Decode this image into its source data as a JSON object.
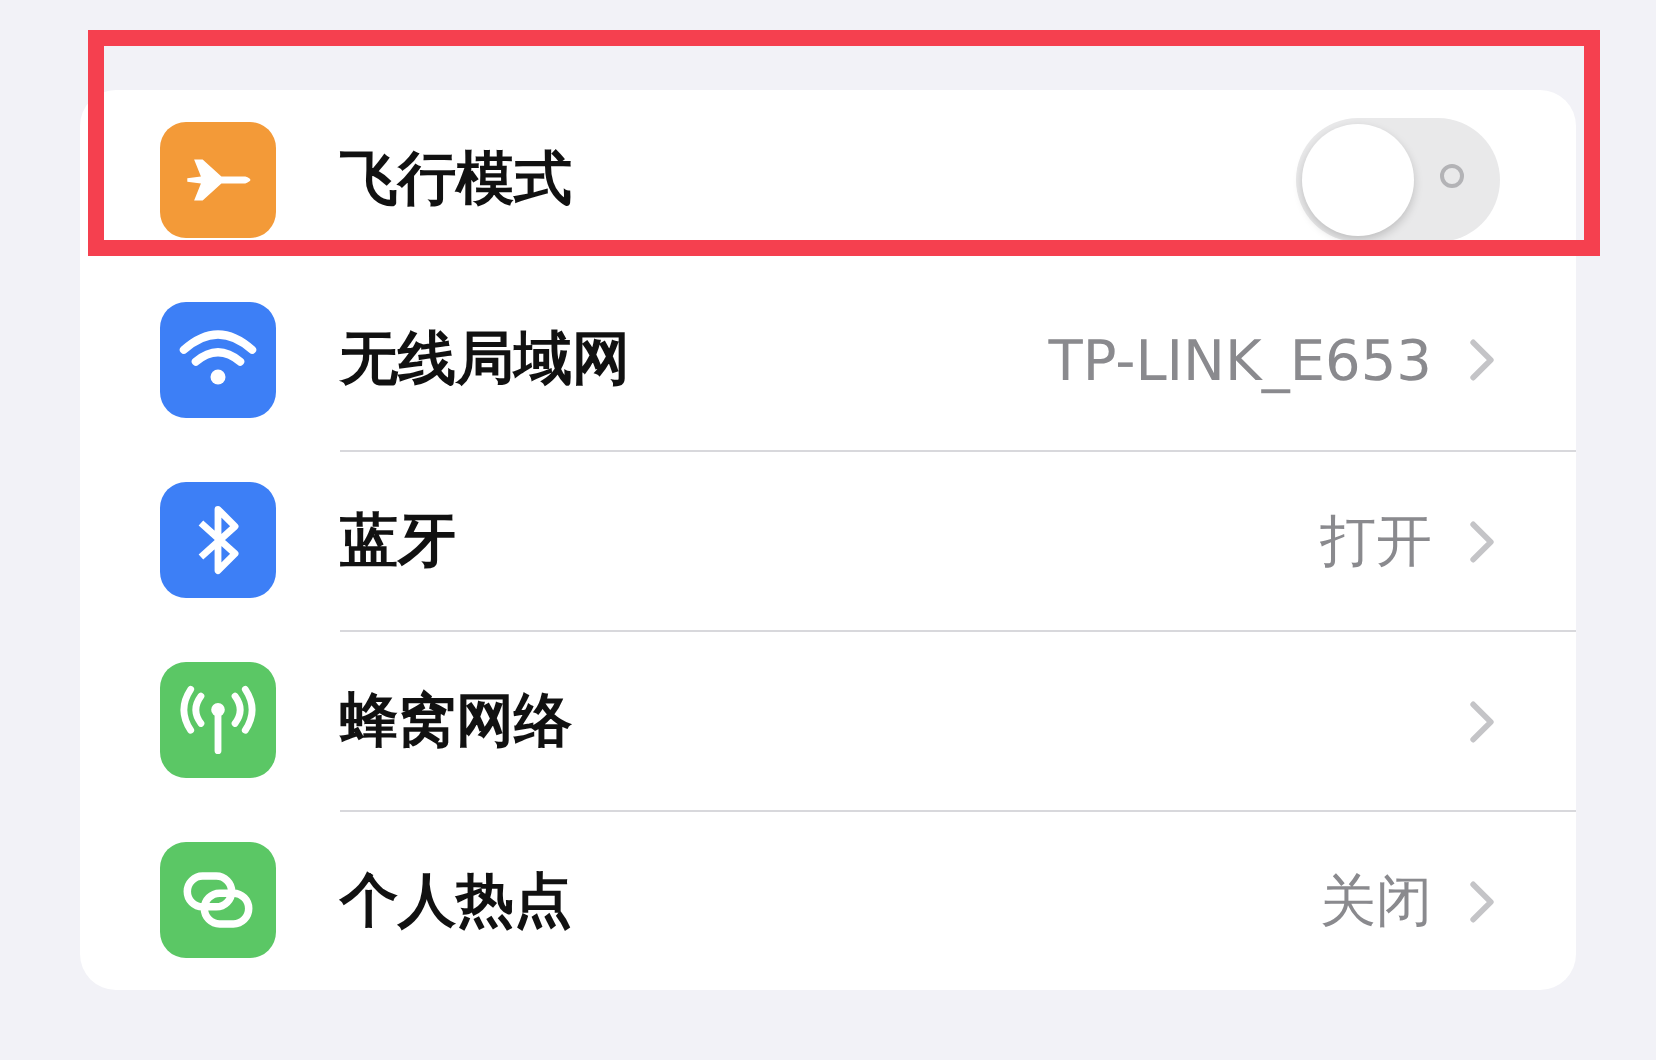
{
  "settings_rows": [
    {
      "label": "飞行模式",
      "kind": "toggle",
      "on": false,
      "color": "#f39a38",
      "highlighted": true
    },
    {
      "label": "无线局域网",
      "kind": "link",
      "value": "TP-LINK_E653",
      "color": "#3d7ff6",
      "highlighted": false
    },
    {
      "label": "蓝牙",
      "kind": "link",
      "value": "打开",
      "color": "#3d7ff6",
      "highlighted": false
    },
    {
      "label": "蜂窝网络",
      "kind": "link",
      "color": "#5bc765",
      "highlighted": false
    },
    {
      "label": "个人热点",
      "kind": "link",
      "value": "关闭",
      "color": "#5bc765",
      "highlighted": false
    }
  ]
}
